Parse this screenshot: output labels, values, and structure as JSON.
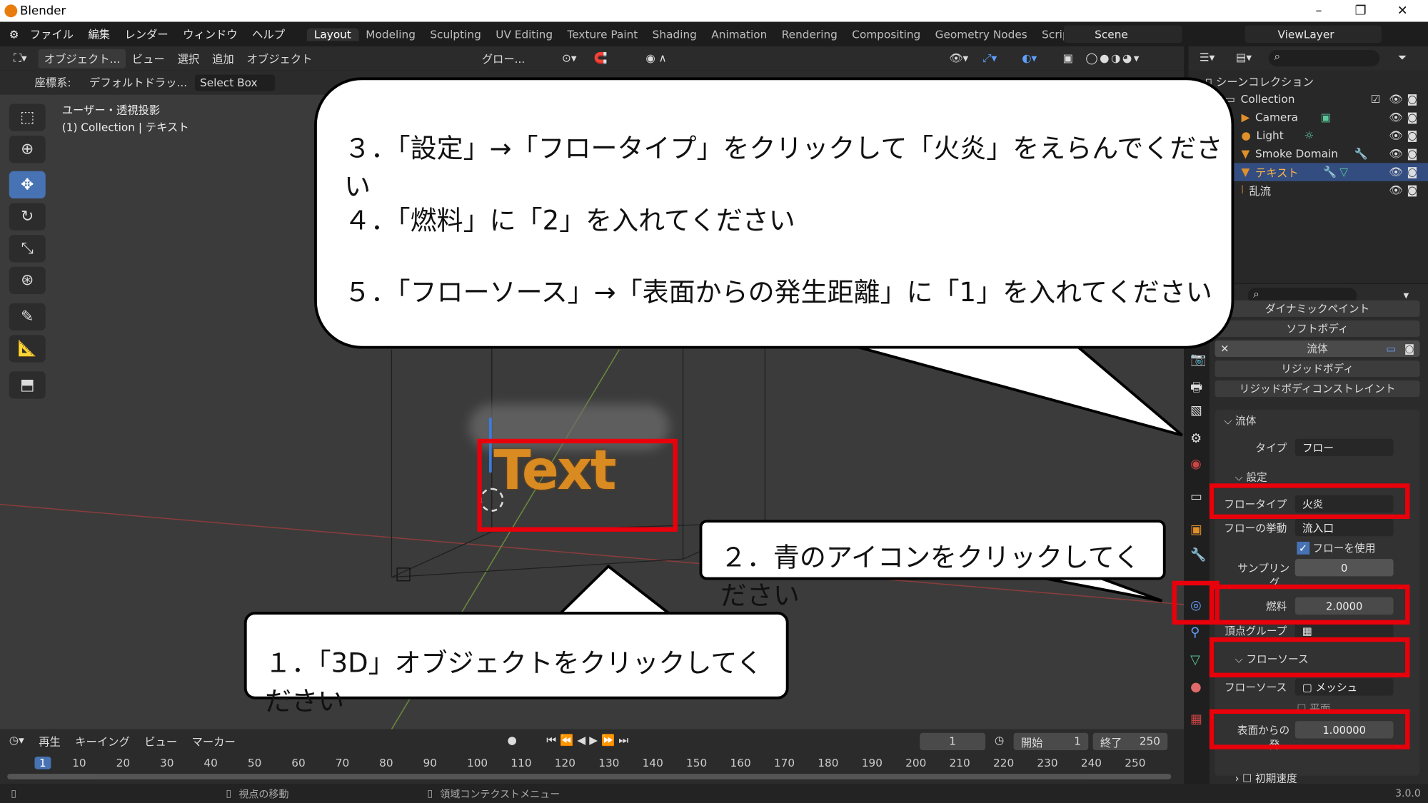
{
  "window": {
    "title": "Blender",
    "minimize": "–",
    "maximize": "❐",
    "close": "✕"
  },
  "menubar": {
    "menus": [
      "ファイル",
      "編集",
      "レンダー",
      "ウィンドウ",
      "ヘルプ"
    ],
    "workspaces": [
      "Layout",
      "Modeling",
      "Sculpting",
      "UV Editing",
      "Texture Paint",
      "Shading",
      "Animation",
      "Rendering",
      "Compositing",
      "Geometry Nodes",
      "Scripting"
    ],
    "active_workspace": "Layout",
    "add_tab": "+",
    "scene": "Scene",
    "view_layer": "ViewLayer"
  },
  "viewport_header": {
    "mode": "オブジェクト...",
    "menus": [
      "ビュー",
      "選択",
      "追加",
      "オブジェクト"
    ],
    "transform": "グロー...",
    "coord_label": "座標系:",
    "coord_value": "デフォルト",
    "drag_label": "ドラッ...",
    "drag_value": "Select Box"
  },
  "viewport": {
    "view_name": "ユーザー・透視投影",
    "collection_info": "(1) Collection | テキスト",
    "object_text": "Text"
  },
  "bubbles": {
    "step3": "３．「設定」→「フロータイプ」をクリックして「火炎」をえらんでください",
    "step4": "４．「燃料」に「2」を入れてください",
    "step5": "５．「フローソース」→「表面からの発生距離」に「1」を入れてください",
    "step2": "２．青のアイコンをクリックしてください",
    "step1": "１．「3D」オブジェクトをクリックしてください"
  },
  "outliner": {
    "header": "シーンコレクション",
    "rows": [
      {
        "name": "Collection",
        "icon": "collection-icon"
      },
      {
        "name": "Camera",
        "icon": "camera-icon"
      },
      {
        "name": "Light",
        "icon": "light-icon"
      },
      {
        "name": "Smoke Domain",
        "icon": "mesh-icon"
      },
      {
        "name": "テキスト",
        "icon": "mesh-icon",
        "selected": true
      },
      {
        "name": "乱流",
        "icon": "force-field-icon"
      }
    ]
  },
  "physics": {
    "buttons": [
      "ダイナミックペイント",
      "ソフトボディ",
      "流体",
      "リジッドボディ",
      "リジッドボディコンストレイント"
    ],
    "panel": "流体",
    "type_label": "タイプ",
    "type_value": "フロー",
    "settings": "設定",
    "flow_type_label": "フロータイプ",
    "flow_type_value": "火炎",
    "flow_behavior_label": "フローの挙動",
    "flow_behavior_value": "流入口",
    "use_flow": "フローを使用",
    "sampling_label": "サンプリング...",
    "sampling_value": "0",
    "fuel_label": "燃料",
    "fuel_value": "2.0000",
    "vertex_group_label": "頂点グループ",
    "flow_source_panel": "フローソース",
    "flow_source_label": "フローソース",
    "flow_source_value": "メッシュ",
    "surface_label": "表面からの発...",
    "surface_value": "1.00000",
    "plane": "平面",
    "initial_velocity": "初期速度"
  },
  "timeline": {
    "menus": [
      "再生",
      "キーイング",
      "ビュー",
      "マーカー"
    ],
    "current_frame": "1",
    "start_label": "開始",
    "start_value": "1",
    "end_label": "終了",
    "end_value": "250",
    "ticks": [
      "1",
      "10",
      "20",
      "30",
      "40",
      "50",
      "60",
      "70",
      "80",
      "90",
      "100",
      "110",
      "120",
      "130",
      "140",
      "150",
      "160",
      "170",
      "180",
      "190",
      "200",
      "210",
      "220",
      "230",
      "240",
      "250"
    ]
  },
  "statusbar": {
    "hint1": "視点の移動",
    "hint2": "領域コンテクストメニュー",
    "version": "3.0.0"
  }
}
